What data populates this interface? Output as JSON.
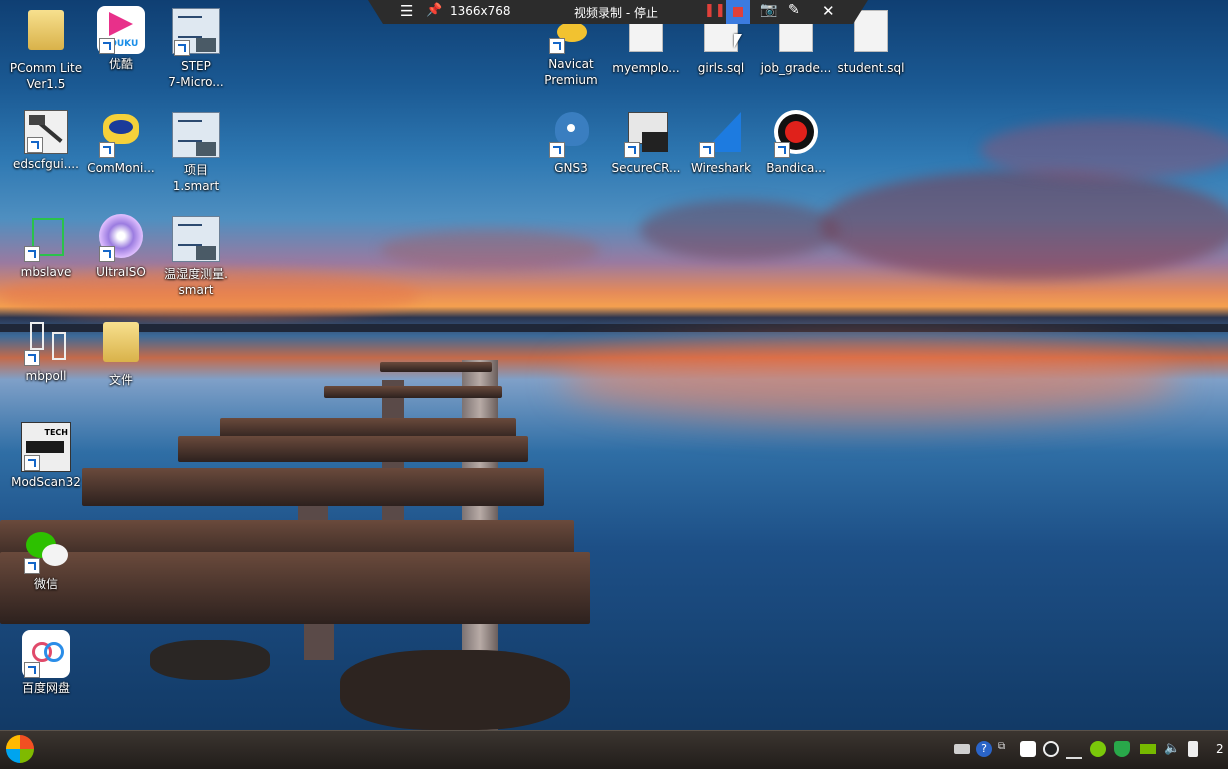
{
  "recorder_toolbar": {
    "resolution": "1366x768",
    "status": "视频录制 - 停止"
  },
  "desktop_icons": {
    "pcomm": "PComm Lite\nVer1.5",
    "youku": "优酷",
    "step7": "STEP\n7-Micro...",
    "navicat": "Navicat\nPremium",
    "myemployees": "myemplo...",
    "girls": "girls.sql",
    "job_grades": "job_grade...",
    "student": "student.sql",
    "edscfgui": "edscfgui....",
    "commonitor": "ComMoni...",
    "project1": "项目 1.smart",
    "gns3": "GNS3",
    "securecrt": "SecureCR...",
    "wireshark": "Wireshark",
    "bandicam": "Bandica...",
    "mbslave": "mbslave",
    "ultraiso": "UltraISO",
    "temp_humidity": "温湿度测量.\nsmart",
    "mbpoll": "mbpoll",
    "wenjian": "文件",
    "modscan": "ModScan32",
    "wechat": "微信",
    "baidu": "百度网盘",
    "youku_logo_text": "YOUKU",
    "modscan_logo_text": "TECH"
  },
  "taskbar": {
    "clock_partial": "2"
  }
}
